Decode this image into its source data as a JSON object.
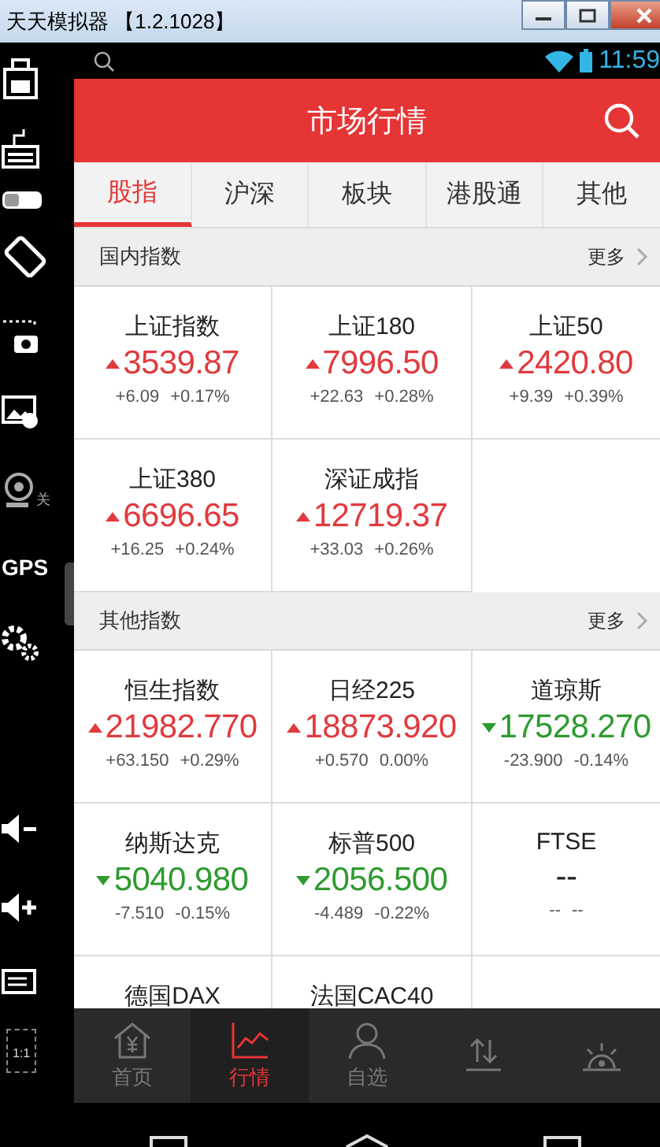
{
  "window": {
    "title": "天天模拟器 【1.2.1028】"
  },
  "sidebar": {
    "items": [
      {
        "kind": "briefcase"
      },
      {
        "kind": "keyboard"
      },
      {
        "kind": "toggle",
        "on": false
      },
      {
        "kind": "rotate"
      },
      {
        "kind": "screenshot"
      },
      {
        "kind": "image"
      },
      {
        "kind": "webcam",
        "label": "关"
      },
      {
        "kind": "gps",
        "label": "GPS"
      },
      {
        "kind": "gears"
      },
      {
        "kind": "gap"
      },
      {
        "kind": "volume-down"
      },
      {
        "kind": "volume-up"
      },
      {
        "kind": "menu"
      },
      {
        "kind": "fullscreen",
        "label": "1:1"
      }
    ]
  },
  "status_bar": {
    "time": "11:59"
  },
  "header": {
    "title": "市场行情"
  },
  "tabs": [
    {
      "label": "股指",
      "selected": true
    },
    {
      "label": "沪深",
      "selected": false
    },
    {
      "label": "板块",
      "selected": false
    },
    {
      "label": "港股通",
      "selected": false
    },
    {
      "label": "其他",
      "selected": false
    }
  ],
  "sections": [
    {
      "title": "国内指数",
      "more": "更多",
      "cells": [
        {
          "name": "上证指数",
          "price": "3539.87",
          "change": "+6.09",
          "pct": "+0.17%",
          "kind": "up"
        },
        {
          "name": "上证180",
          "price": "7996.50",
          "change": "+22.63",
          "pct": "+0.28%",
          "kind": "up"
        },
        {
          "name": "上证50",
          "price": "2420.80",
          "change": "+9.39",
          "pct": "+0.39%",
          "kind": "up"
        },
        {
          "name": "上证380",
          "price": "6696.65",
          "change": "+16.25",
          "pct": "+0.24%",
          "kind": "up"
        },
        {
          "name": "深证成指",
          "price": "12719.37",
          "change": "+33.03",
          "pct": "+0.26%",
          "kind": "up"
        }
      ]
    },
    {
      "title": "其他指数",
      "more": "更多",
      "cells": [
        {
          "name": "恒生指数",
          "price": "21982.770",
          "change": "+63.150",
          "pct": "+0.29%",
          "kind": "up"
        },
        {
          "name": "日经225",
          "price": "18873.920",
          "change": "+0.570",
          "pct": "0.00%",
          "kind": "up"
        },
        {
          "name": "道琼斯",
          "price": "17528.270",
          "change": "-23.900",
          "pct": "-0.14%",
          "kind": "down"
        },
        {
          "name": "纳斯达克",
          "price": "5040.980",
          "change": "-7.510",
          "pct": "-0.15%",
          "kind": "down"
        },
        {
          "name": "标普500",
          "price": "2056.500",
          "change": "-4.489",
          "pct": "-0.22%",
          "kind": "down"
        },
        {
          "name": "FTSE",
          "price": "--",
          "change": "--",
          "pct": "--",
          "kind": "none"
        },
        {
          "name": "德国DAX"
        },
        {
          "name": "法国CAC40"
        }
      ]
    }
  ],
  "bottom_nav": [
    {
      "kind": "home",
      "label": "首页",
      "selected": false
    },
    {
      "kind": "chart",
      "label": "行情",
      "selected": true
    },
    {
      "kind": "person",
      "label": "自选",
      "selected": false
    },
    {
      "kind": "transfer",
      "selected": false
    },
    {
      "kind": "lamp",
      "selected": false
    }
  ]
}
